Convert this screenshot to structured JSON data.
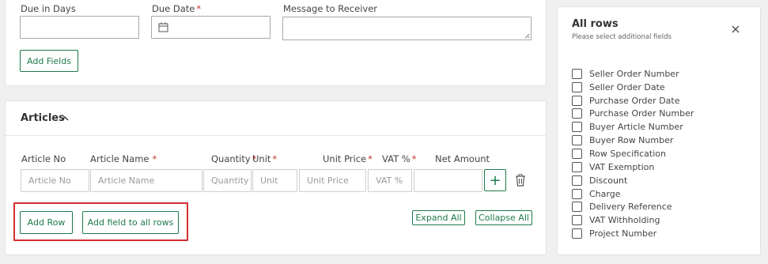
{
  "top_form": {
    "due_in_days_label": "Due in Days",
    "due_date_label": "Due Date",
    "message_label": "Message to Receiver",
    "required_mark": "*",
    "add_fields_button": "Add Fields"
  },
  "articles": {
    "title": "Articles",
    "columns": {
      "article_no": "Article No",
      "article_name": "Article Name",
      "quantity": "Quantity",
      "unit": "Unit",
      "unit_price": "Unit Price",
      "vat": "VAT %",
      "net_amount": "Net Amount"
    },
    "placeholders": {
      "article_no": "Article No",
      "article_name": "Article Name",
      "quantity": "Quantity",
      "unit": "Unit",
      "unit_price": "Unit Price",
      "vat": "VAT %"
    },
    "add_row_button": "Add Row",
    "add_field_all_button": "Add field to all rows",
    "expand_all_button": "Expand All",
    "collapse_all_button": "Collapse All",
    "plus_symbol": "+"
  },
  "side_panel": {
    "title": "All rows",
    "subtitle": "Please select additional fields",
    "fields": [
      "Seller Order Number",
      "Seller Order Date",
      "Purchase Order Date",
      "Purchase Order Number",
      "Buyer Article Number",
      "Buyer Row Number",
      "Row Specification",
      "VAT Exemption",
      "Discount",
      "Charge",
      "Delivery Reference",
      "VAT Withholding",
      "Project Number"
    ]
  },
  "colors": {
    "accent": "#1e7a4c",
    "required": "#c0392b",
    "highlight": "#d32f2f"
  },
  "icons": [
    "calendar-icon",
    "chevron-up-icon",
    "trash-icon",
    "close-icon",
    "plus-icon"
  ]
}
